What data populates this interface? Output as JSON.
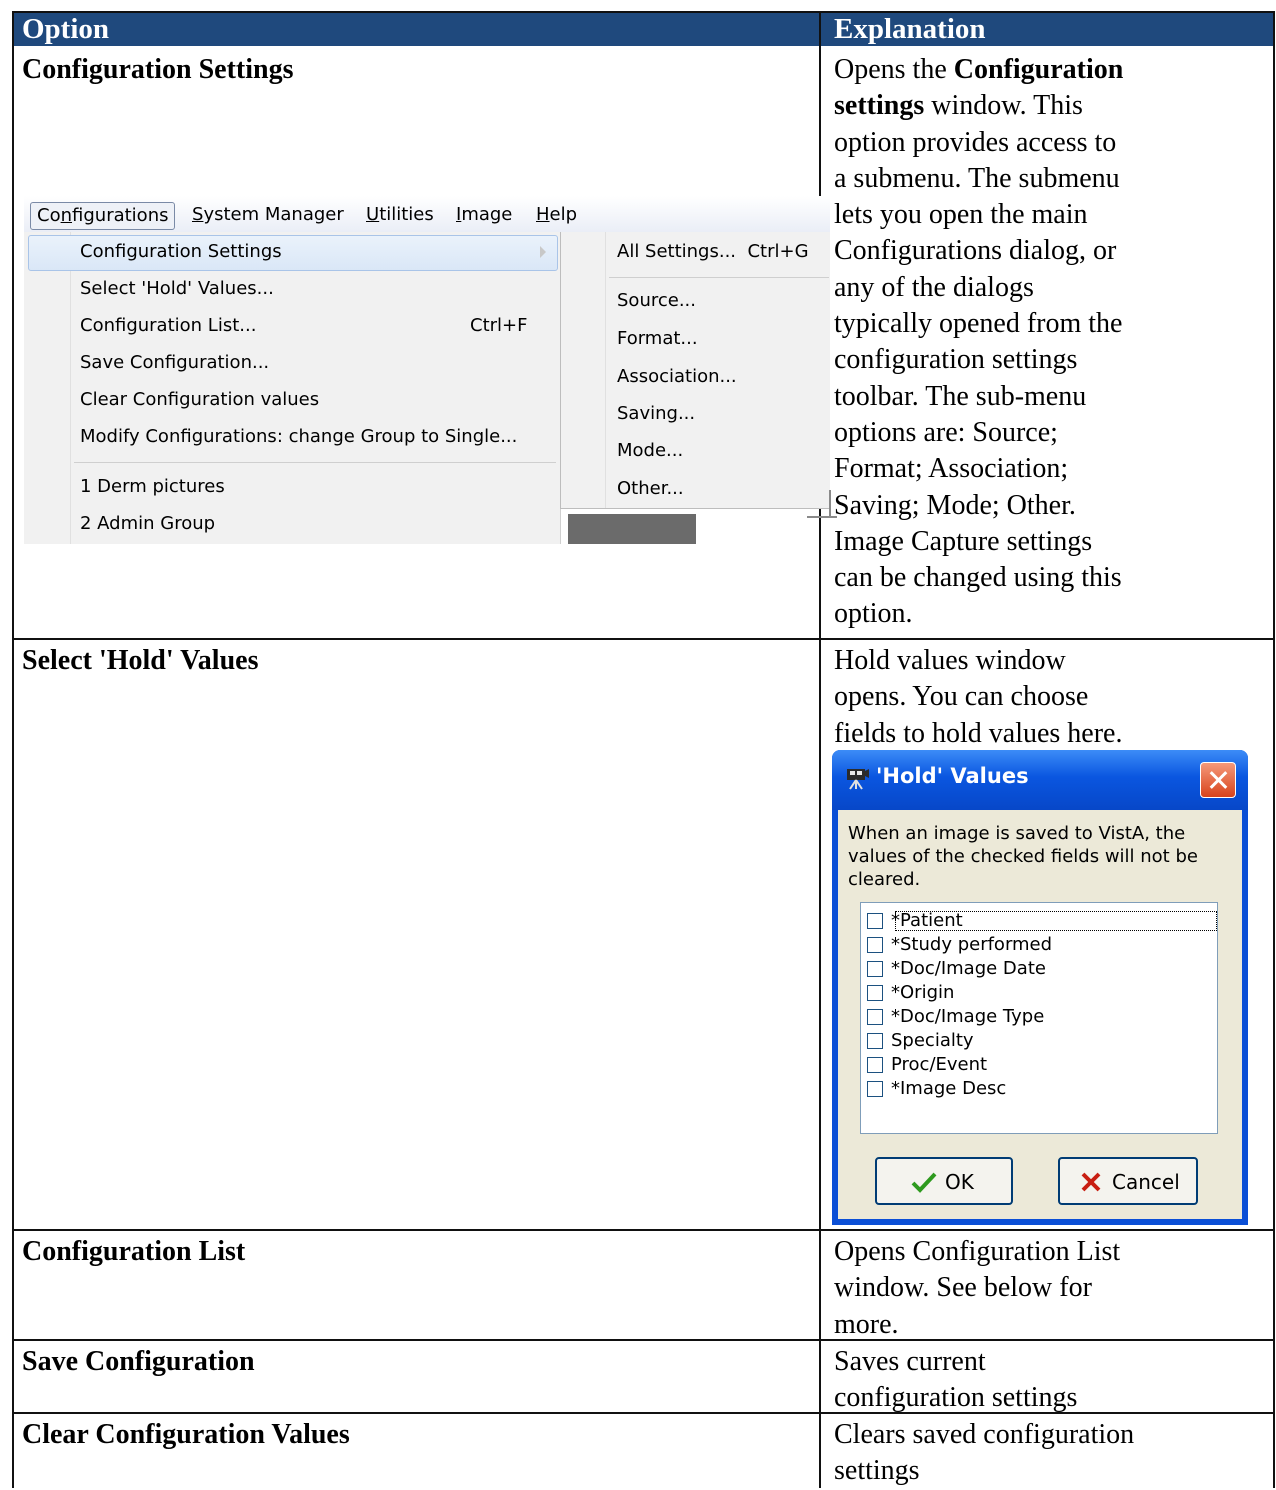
{
  "table": {
    "headers": {
      "option": "Option",
      "explanation": "Explanation"
    },
    "header_color": "#1f497d",
    "rows": [
      {
        "option": "Configuration Settings",
        "explanation_lines": [
          [
            "Opens the ",
            {
              "b": "Configuration"
            }
          ],
          [
            {
              "b": "settings"
            },
            " window. This"
          ],
          [
            "option provides access to"
          ],
          [
            "a submenu. The submenu"
          ],
          [
            "lets you open the main"
          ],
          [
            "Configurations dialog, or"
          ],
          [
            "any of the dialogs"
          ],
          [
            "typically opened from the"
          ],
          [
            "configuration settings"
          ],
          [
            "toolbar. The sub-menu"
          ],
          [
            "options are: Source;"
          ],
          [
            "Format; Association;"
          ],
          [
            "Saving; Mode; Other."
          ],
          [
            "Image Capture settings"
          ],
          [
            "can be changed using this"
          ],
          [
            "option."
          ]
        ]
      },
      {
        "option": "Select 'Hold' Values",
        "explanation_lines": [
          [
            "Hold values window"
          ],
          [
            "opens. You can choose"
          ],
          [
            "fields to hold values here."
          ]
        ]
      },
      {
        "option": "Configuration List",
        "explanation_lines": [
          [
            "Opens Configuration List"
          ],
          [
            "window. See below for"
          ],
          [
            "more."
          ]
        ]
      },
      {
        "option": "Save Configuration",
        "explanation_lines": [
          [
            "Saves current"
          ],
          [
            "configuration settings"
          ]
        ]
      },
      {
        "option": "Clear Configuration Values",
        "explanation_lines": [
          [
            "Clears saved configuration"
          ],
          [
            "settings"
          ]
        ]
      }
    ]
  },
  "menu": {
    "menubar": [
      {
        "label": "Configurations",
        "accel": 2
      },
      {
        "label": "System Manager",
        "accel": 0
      },
      {
        "label": "Utilities",
        "accel": 0
      },
      {
        "label": "Image",
        "accel": 0
      },
      {
        "label": "Help",
        "accel": 0
      }
    ],
    "items": [
      {
        "label": "Configuration Settings",
        "highlight": true,
        "submenu": true
      },
      {
        "label": "Select 'Hold' Values..."
      },
      {
        "label": "Configuration List...",
        "shortcut": "Ctrl+F"
      },
      {
        "label": "Save Configuration..."
      },
      {
        "label": "Clear Configuration values"
      },
      {
        "label": "Modify Configurations: change Group to Single...",
        "sep_after": true
      },
      {
        "label": "1  Derm pictures"
      },
      {
        "label": "2  Admin Group"
      }
    ],
    "submenu_items": [
      {
        "label": "All Settings...  Ctrl+G",
        "sep_after": true
      },
      {
        "label": "Source..."
      },
      {
        "label": "Format..."
      },
      {
        "label": "Association..."
      },
      {
        "label": "Saving..."
      },
      {
        "label": "Mode..."
      },
      {
        "label": "Other..."
      }
    ]
  },
  "dialog": {
    "title": "'Hold' Values",
    "description": "When an image is saved to VistA, the values of the checked fields will not be cleared.",
    "fields": [
      "*Patient",
      "*Study performed",
      "*Doc/Image Date",
      "*Origin",
      "*Doc/Image Type",
      "Specialty",
      "Proc/Event",
      "*Image Desc"
    ],
    "ok_label": "OK",
    "cancel_label": "Cancel",
    "icons": {
      "close": "close-icon",
      "camera": "camera-icon",
      "ok": "checkmark-icon",
      "cancel": "x-mark-icon"
    }
  }
}
